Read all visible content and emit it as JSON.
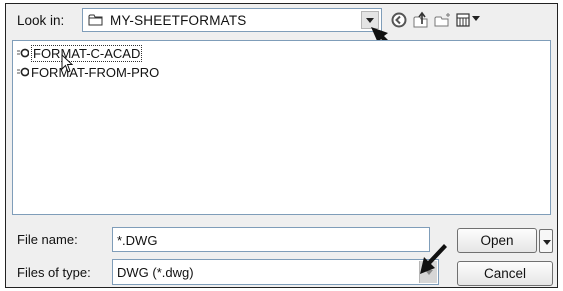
{
  "look_in": {
    "label": "Look in:",
    "value": "MY-SHEETFORMATS"
  },
  "toolbar": {
    "icons": [
      "back-icon",
      "up-folder-icon",
      "new-folder-icon",
      "view-menu-icon"
    ]
  },
  "files": [
    {
      "name": "FORMAT-C-ACAD",
      "selected": true
    },
    {
      "name": "FORMAT-FROM-PRO",
      "selected": false
    }
  ],
  "file_name": {
    "label": "File name:",
    "value": "*.DWG"
  },
  "file_type": {
    "label": "Files of type:",
    "value": "DWG (*.dwg)"
  },
  "buttons": {
    "open": "Open",
    "cancel": "Cancel"
  }
}
